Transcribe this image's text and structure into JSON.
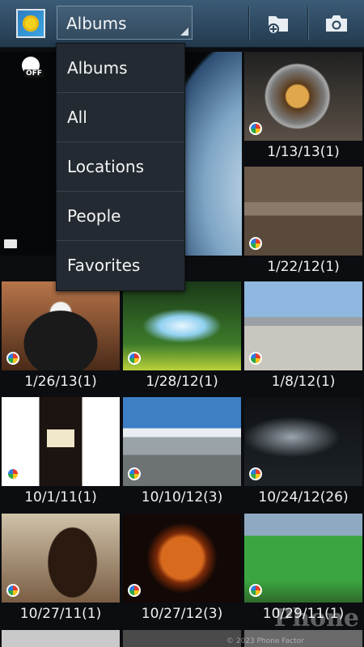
{
  "actionbar": {
    "selected_view": "Albums"
  },
  "menu": {
    "items": [
      "Albums",
      "All",
      "Locations",
      "People",
      "Favorites"
    ]
  },
  "tiles": [
    {
      "caption": "1/13/13(1)"
    },
    {
      "caption": "1/22/12(1)"
    },
    {
      "caption": "1/26/13(1)"
    },
    {
      "caption": "1/28/12(1)"
    },
    {
      "caption": "1/8/12(1)"
    },
    {
      "caption": "10/1/11(1)"
    },
    {
      "caption": "10/10/12(3)"
    },
    {
      "caption": "10/24/12(26)"
    },
    {
      "caption": "10/27/11(1)"
    },
    {
      "caption": "10/27/12(3)"
    },
    {
      "caption": "10/29/11(1)"
    }
  ],
  "overlay": {
    "off_label": "OFF"
  },
  "watermark": {
    "text": "Phone"
  },
  "footer": {
    "text": "© 2023 Phone Factor"
  }
}
